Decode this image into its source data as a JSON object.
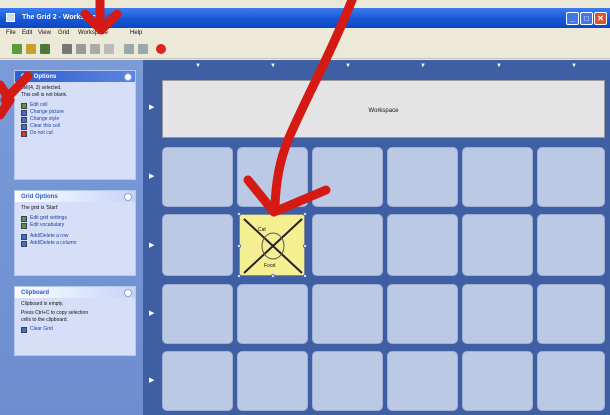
{
  "window": {
    "title": "The Grid 2 - Workspace",
    "controls": [
      "_",
      "□",
      "✕"
    ]
  },
  "menu": [
    "File",
    "Edit",
    "View",
    "Grid",
    "Workspace",
    "Help"
  ],
  "toolbar": {
    "icons": [
      "new-icon",
      "open-icon",
      "save-icon",
      "cut-icon",
      "copy-icon",
      "paste-icon",
      "undo-icon",
      "zoom-icon",
      "grid-icon",
      "record-icon"
    ]
  },
  "panels": {
    "cell_options": {
      "title": "Cell Options",
      "lines": [
        "cell(4, 3) selected.",
        "This cell is not blank."
      ],
      "tasks": [
        "Edit cell",
        "Change picture",
        "Change style",
        "Clear this cell",
        "Do not cut"
      ]
    },
    "grid_options": {
      "title": "Grid Options",
      "lines": [
        "The grid is 'Start'"
      ],
      "tasks": [
        "Edit grid settings",
        "Edit vocabulary",
        "Add/Delete a row",
        "Add/Delete a column"
      ]
    },
    "clipboard": {
      "title": "Clipboard",
      "lines": [
        "Clipboard is empty.",
        "Press Ctrl+C to copy selection",
        "cells to the clipboard."
      ],
      "tasks": [
        "Clear Grid"
      ]
    }
  },
  "workspace": {
    "label": "Workspace",
    "selected_cell": {
      "top": "Cat",
      "bottom": "Food"
    }
  },
  "colors": {
    "annotation": "#d41a12",
    "workspace_bg": "#3f5fa5",
    "cell": "#bcc9e4",
    "selected": "#f5ef92"
  }
}
